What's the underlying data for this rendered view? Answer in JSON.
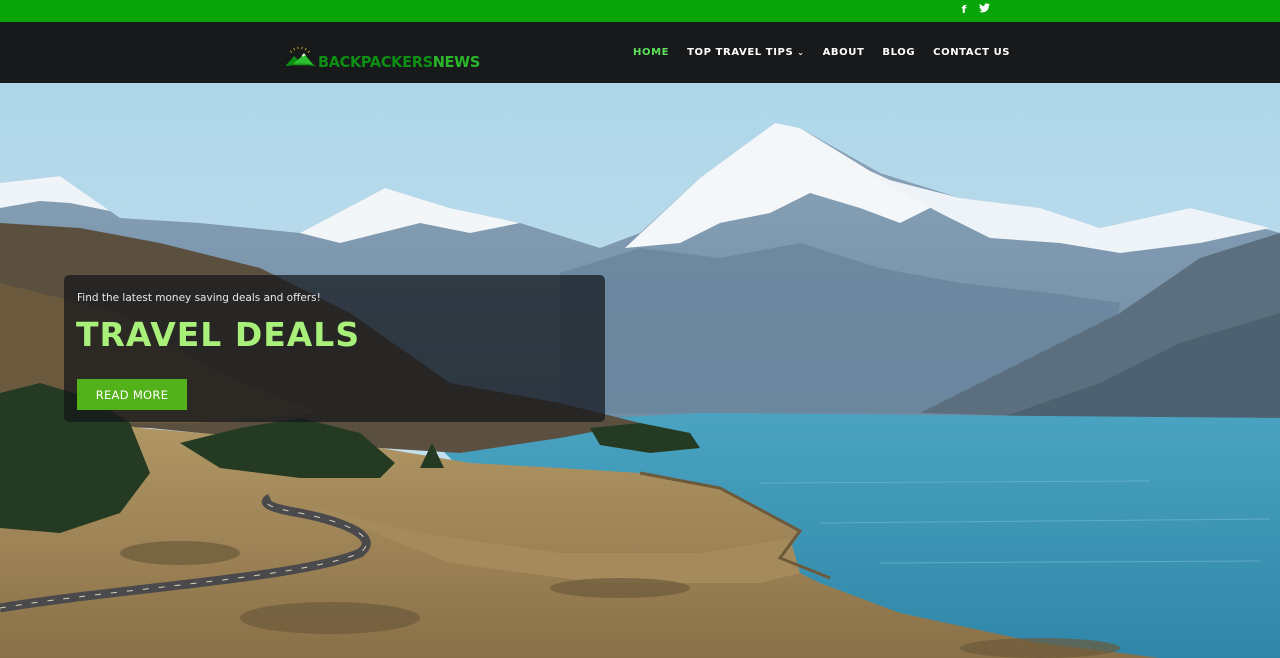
{
  "topbar": {
    "social": [
      {
        "icon": "facebook-icon",
        "glyph": "f"
      },
      {
        "icon": "twitter-icon",
        "glyph": "🐦"
      }
    ],
    "accent": "#07a40a"
  },
  "header": {
    "logo": {
      "word1": "BACKPACKERS",
      "word2": "NEWS"
    },
    "nav": [
      {
        "label": "HOME",
        "active": true
      },
      {
        "label": "TOP TRAVEL TIPS",
        "dropdown": true
      },
      {
        "label": "ABOUT"
      },
      {
        "label": "BLOG"
      },
      {
        "label": "CONTACT US"
      }
    ]
  },
  "hero": {
    "kicker": "Find the latest money saving deals and offers!",
    "title": "TRAVEL DEALS",
    "button": "READ MORE"
  },
  "colors": {
    "header_bg": "#18191b",
    "nav_active": "#5de15a",
    "title": "#a8f07a",
    "button": "#53b21a"
  }
}
